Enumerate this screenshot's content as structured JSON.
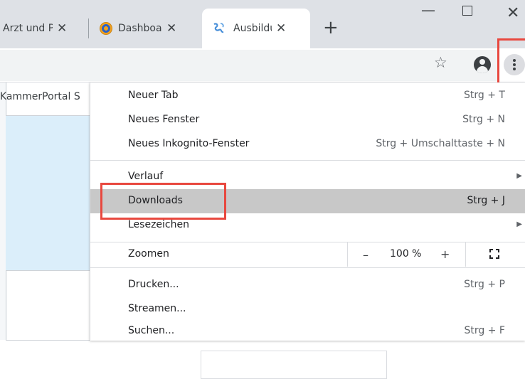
{
  "tabs": [
    {
      "title": "Arzt und Patient",
      "close": "✕"
    },
    {
      "title": "Dashboard",
      "close": "✕"
    },
    {
      "title": "Ausbildung",
      "close": "✕"
    }
  ],
  "window": {
    "minimize": "—",
    "close": "✕"
  },
  "page": {
    "link_text": "KammerPortal S"
  },
  "menu": {
    "new_tab": {
      "label": "Neuer Tab",
      "shortcut": "Strg + T"
    },
    "new_window": {
      "label": "Neues Fenster",
      "shortcut": "Strg + N"
    },
    "incognito": {
      "label": "Neues Inkognito-Fenster",
      "shortcut": "Strg + Umschalttaste + N"
    },
    "history": {
      "label": "Verlauf"
    },
    "downloads": {
      "label": "Downloads",
      "shortcut": "Strg + J"
    },
    "bookmarks": {
      "label": "Lesezeichen"
    },
    "zoom": {
      "label": "Zoomen",
      "minus": "–",
      "value": "100 %",
      "plus": "+"
    },
    "print": {
      "label": "Drucken...",
      "shortcut": "Strg + P"
    },
    "cast": {
      "label": "Streamen..."
    },
    "find": {
      "label": "Suchen...",
      "shortcut": "Strg + F"
    }
  },
  "icons": {
    "star": "star-icon",
    "profile": "profile-icon",
    "menu": "kebab-menu-icon",
    "new_tab": "plus-icon"
  },
  "colors": {
    "highlight": "#e8483f",
    "active_item": "#c8c8c8",
    "page_panel": "#dbeefa"
  }
}
